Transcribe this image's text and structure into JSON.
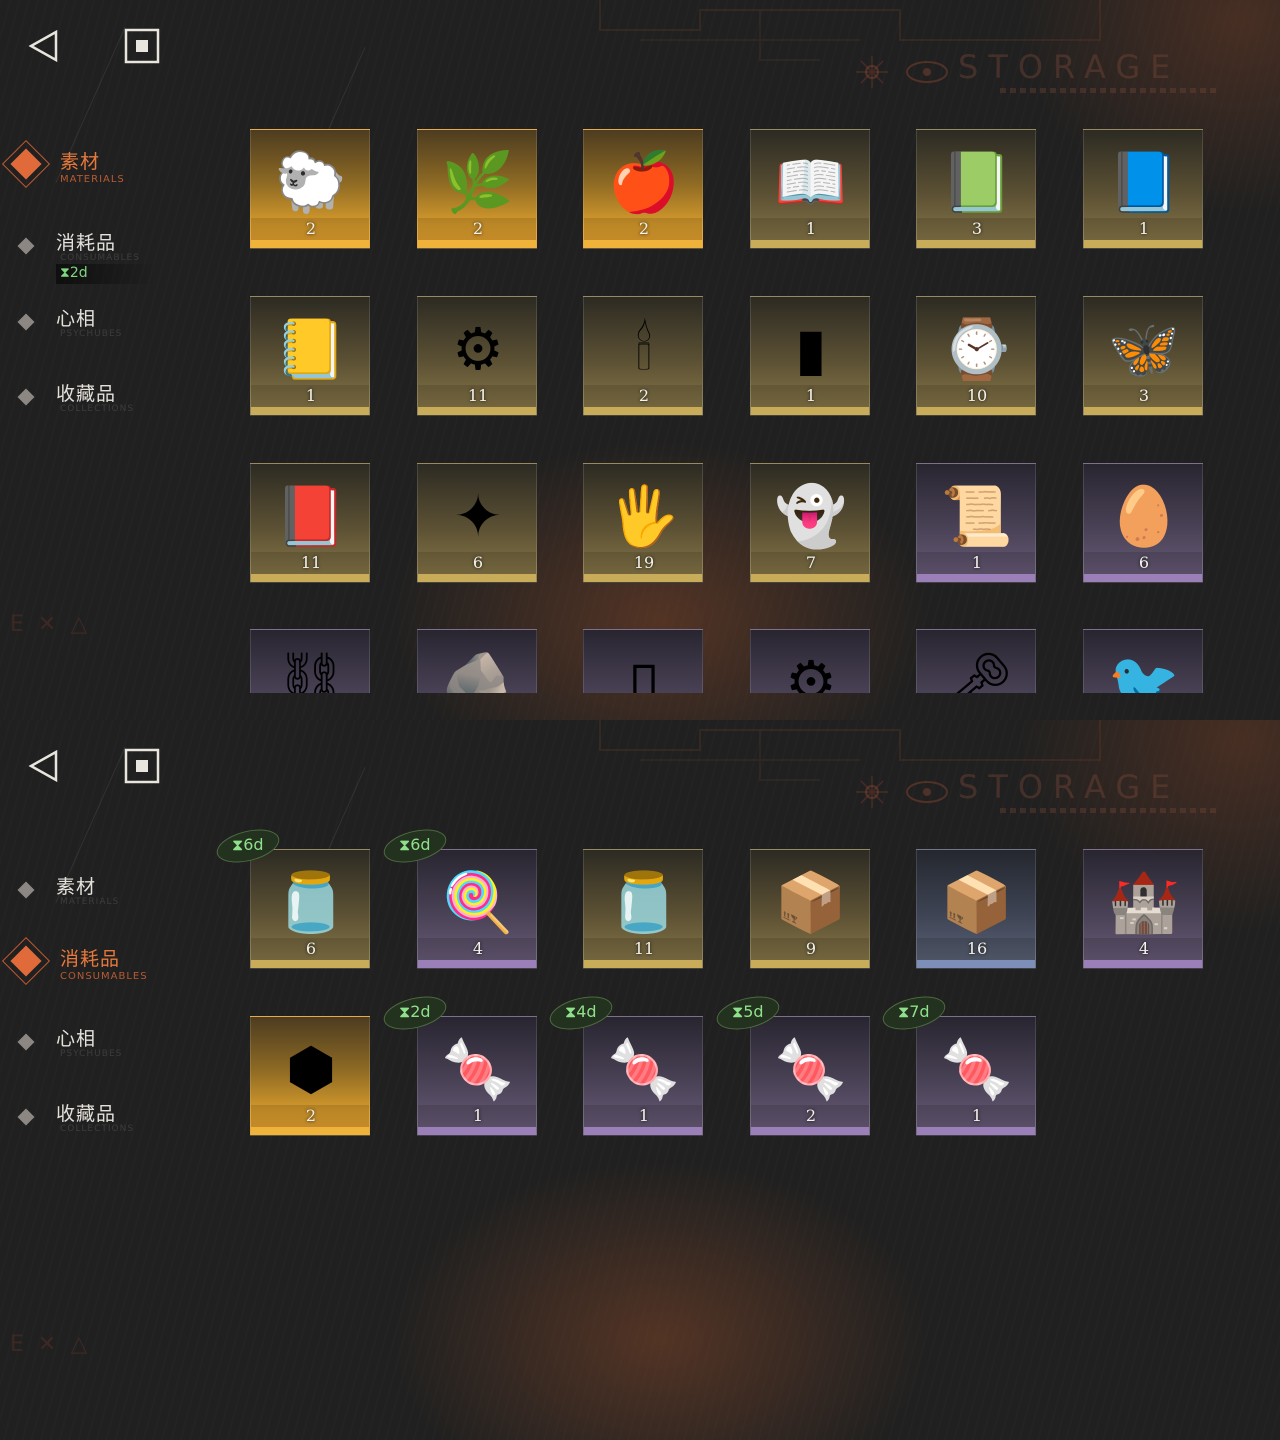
{
  "storage_title": "STORAGE",
  "top": {
    "nav": [
      {
        "label": "素材",
        "sub": "MATERIALS",
        "active": true
      },
      {
        "label": "消耗品",
        "sub": "CONSUMABLES",
        "active": false
      },
      {
        "label": "心相",
        "sub": "PSYCHUBES",
        "active": false
      },
      {
        "label": "收藏品",
        "sub": "COLLECTIONS",
        "active": false
      }
    ],
    "nav_timer": "2d",
    "items": [
      {
        "name": "golden-sheep",
        "count": "2",
        "rarity": "gold",
        "icon": "sheep-icon",
        "glyph": "🐑"
      },
      {
        "name": "laurel-wreath",
        "count": "2",
        "rarity": "gold",
        "icon": "laurel-icon",
        "glyph": "🌿"
      },
      {
        "name": "apple-serpent",
        "count": "2",
        "rarity": "gold",
        "icon": "apple-snake-icon",
        "glyph": "🍎"
      },
      {
        "name": "book-red",
        "count": "1",
        "rarity": "yellow",
        "icon": "book-red-icon",
        "glyph": "📖"
      },
      {
        "name": "book-green",
        "count": "3",
        "rarity": "yellow",
        "icon": "book-green-icon",
        "glyph": "📗"
      },
      {
        "name": "book-blue",
        "count": "1",
        "rarity": "yellow",
        "icon": "book-blue-icon",
        "glyph": "📘"
      },
      {
        "name": "book-gold",
        "count": "1",
        "rarity": "yellow",
        "icon": "book-gold-icon",
        "glyph": "📒"
      },
      {
        "name": "astrolabe",
        "count": "11",
        "rarity": "yellow",
        "icon": "astrolabe-icon",
        "glyph": "⚙"
      },
      {
        "name": "ouija-board",
        "count": "2",
        "rarity": "yellow",
        "icon": "ouija-icon",
        "glyph": "🕯"
      },
      {
        "name": "green-tablet",
        "count": "1",
        "rarity": "yellow",
        "icon": "green-tablet-icon",
        "glyph": "▮"
      },
      {
        "name": "pocket-watch",
        "count": "10",
        "rarity": "yellow",
        "icon": "watch-icon",
        "glyph": "⌚"
      },
      {
        "name": "firefly",
        "count": "3",
        "rarity": "yellow",
        "icon": "firefly-icon",
        "glyph": "🦋"
      },
      {
        "name": "dark-tome",
        "count": "11",
        "rarity": "yellow",
        "icon": "dark-tome-icon",
        "glyph": "📕"
      },
      {
        "name": "silver-bullets",
        "count": "6",
        "rarity": "yellow",
        "icon": "bullets-icon",
        "glyph": "✦"
      },
      {
        "name": "hand-box",
        "count": "19",
        "rarity": "yellow",
        "icon": "hand-box-icon",
        "glyph": "🖐"
      },
      {
        "name": "ghost",
        "count": "7",
        "rarity": "yellow",
        "icon": "ghost-icon",
        "glyph": "👻"
      },
      {
        "name": "scroll",
        "count": "1",
        "rarity": "purple",
        "icon": "scroll-icon",
        "glyph": "📜"
      },
      {
        "name": "jeweled-egg",
        "count": "6",
        "rarity": "purple",
        "icon": "egg-icon",
        "glyph": "🥚"
      }
    ],
    "partial_items": [
      {
        "icon": "chain-icon",
        "glyph": "⛓"
      },
      {
        "icon": "stone-icon",
        "glyph": "🪨"
      },
      {
        "icon": "case-icon",
        "glyph": "▯"
      },
      {
        "icon": "gear-mask-icon",
        "glyph": "⚙"
      },
      {
        "icon": "winged-key-icon",
        "glyph": "🗝"
      },
      {
        "icon": "bird-icon",
        "glyph": "🐦"
      }
    ]
  },
  "bottom": {
    "nav": [
      {
        "label": "素材",
        "sub": "MATERIALS",
        "active": false
      },
      {
        "label": "消耗品",
        "sub": "CONSUMABLES",
        "active": true
      },
      {
        "label": "心相",
        "sub": "PSYCHUBES",
        "active": false
      },
      {
        "label": "收藏品",
        "sub": "COLLECTIONS",
        "active": false
      }
    ],
    "items": [
      {
        "name": "candy-jar",
        "count": "6",
        "rarity": "yellow",
        "icon": "candy-jar-icon",
        "glyph": "🫙",
        "timer": "6d"
      },
      {
        "name": "lollipops",
        "count": "4",
        "rarity": "purple",
        "icon": "lollipop-icon",
        "glyph": "🍭",
        "timer": "6d"
      },
      {
        "name": "candy-jar-2",
        "count": "11",
        "rarity": "yellow",
        "icon": "candy-jar-icon",
        "glyph": "🫙",
        "timer": ""
      },
      {
        "name": "parcel",
        "count": "9",
        "rarity": "yellow",
        "icon": "parcel-icon",
        "glyph": "📦",
        "timer": ""
      },
      {
        "name": "parcel-blue",
        "count": "16",
        "rarity": "blue",
        "icon": "parcel-icon",
        "glyph": "📦",
        "timer": ""
      },
      {
        "name": "castle",
        "count": "4",
        "rarity": "purple",
        "icon": "castle-icon",
        "glyph": "🏰",
        "timer": ""
      },
      {
        "name": "emblem",
        "count": "2",
        "rarity": "gold",
        "icon": "emblem-icon",
        "glyph": "⬢",
        "timer": ""
      },
      {
        "name": "candies-1",
        "count": "1",
        "rarity": "purple",
        "icon": "candies-icon",
        "glyph": "🍬",
        "timer": "2d"
      },
      {
        "name": "candies-2",
        "count": "1",
        "rarity": "purple",
        "icon": "candies-icon",
        "glyph": "🍬",
        "timer": "4d"
      },
      {
        "name": "candies-3",
        "count": "2",
        "rarity": "purple",
        "icon": "candies-icon",
        "glyph": "🍬",
        "timer": "5d"
      },
      {
        "name": "candies-4",
        "count": "1",
        "rarity": "purple",
        "icon": "candies-icon",
        "glyph": "🍬",
        "timer": "7d"
      }
    ]
  },
  "colors": {
    "accent": "#e06a3a",
    "timer": "#8fe08a",
    "gold": "#efb23a",
    "purple": "#9a7fb8"
  }
}
